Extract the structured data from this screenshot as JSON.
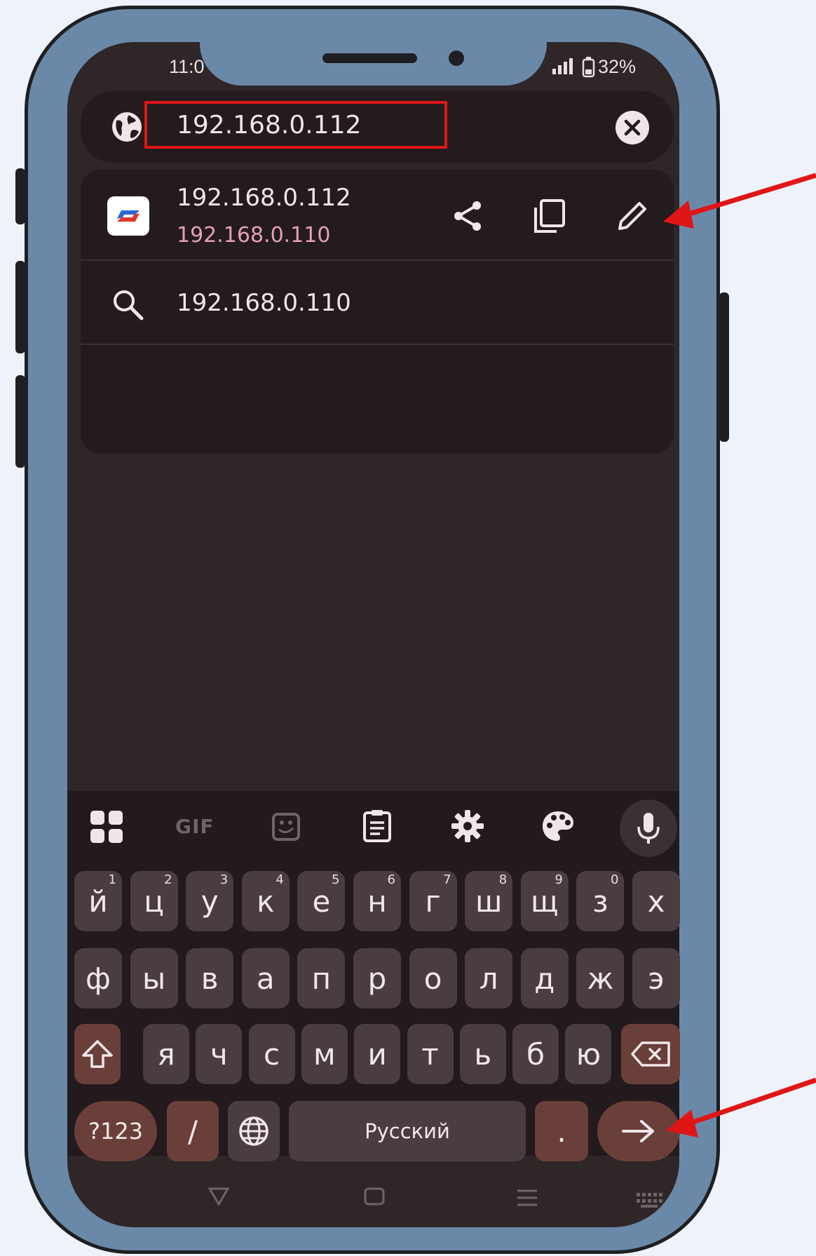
{
  "status_bar": {
    "time": "11:0",
    "battery": "32%"
  },
  "url_bar": {
    "value": "192.168.0.112"
  },
  "suggestions": [
    {
      "title": "192.168.0.112",
      "subtitle": "192.168.0.110"
    },
    {
      "title": "192.168.0.110"
    }
  ],
  "keyboard": {
    "toolbar": [
      "apps",
      "GIF",
      "sticker",
      "clipboard",
      "settings",
      "theme",
      "mic"
    ],
    "gif_label": "GIF",
    "row1": [
      {
        "k": "й",
        "n": "1"
      },
      {
        "k": "ц",
        "n": "2"
      },
      {
        "k": "у",
        "n": "3"
      },
      {
        "k": "к",
        "n": "4"
      },
      {
        "k": "е",
        "n": "5"
      },
      {
        "k": "н",
        "n": "6"
      },
      {
        "k": "г",
        "n": "7"
      },
      {
        "k": "ш",
        "n": "8"
      },
      {
        "k": "щ",
        "n": "9"
      },
      {
        "k": "з",
        "n": "0"
      },
      {
        "k": "х",
        "n": ""
      }
    ],
    "row2": [
      "ф",
      "ы",
      "в",
      "а",
      "п",
      "р",
      "о",
      "л",
      "д",
      "ж",
      "э"
    ],
    "row3": [
      "я",
      "ч",
      "с",
      "м",
      "и",
      "т",
      "ь",
      "б",
      "ю"
    ],
    "symbols_label": "?123",
    "slash_label": "/",
    "space_label": "Русский",
    "period_label": "."
  },
  "colors": {
    "highlight_box": "#e01616",
    "annotation_arrow": "#e01616",
    "frame": "#6a89a8"
  }
}
